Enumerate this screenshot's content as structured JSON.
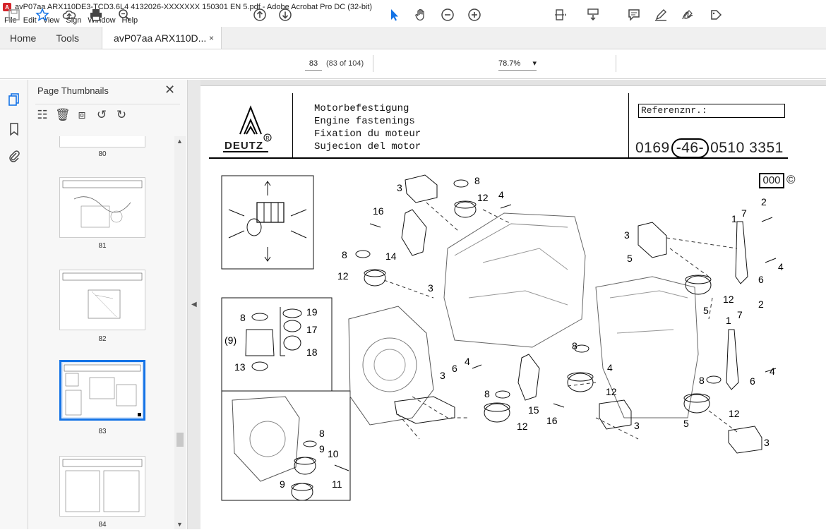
{
  "window": {
    "title": "avP07aa ARX110DE3-TCD3.6L4 4132026-XXXXXXX 150301 EN 5.pdf - Adobe Acrobat Pro DC (32-bit)",
    "app_icon": "acrobat-icon"
  },
  "menu": [
    "File",
    "Edit",
    "View",
    "Sign",
    "Window",
    "Help"
  ],
  "tabs": {
    "home": "Home",
    "tools": "Tools",
    "document": "avP07aa ARX110D...",
    "close": "×"
  },
  "toolbar": {
    "page_current": "83",
    "page_count": "(83 of 104)",
    "zoom": "78.7%",
    "zoom_caret": "▾"
  },
  "panel": {
    "title": "Page Thumbnails",
    "close": "✕",
    "thumbnails": [
      {
        "label": "80",
        "selected": false
      },
      {
        "label": "81",
        "selected": false
      },
      {
        "label": "82",
        "selected": false
      },
      {
        "label": "83",
        "selected": true
      },
      {
        "label": "84",
        "selected": false
      }
    ]
  },
  "document": {
    "titles": [
      "Motorbefestigung",
      "Engine fastenings",
      "Fixation du moteur",
      "Sujecion del motor"
    ],
    "logo_text": "DEUTZ",
    "ref_label": "Referenznr.:",
    "ref_prefix": "0169",
    "ref_oval": "-46-",
    "ref_rest": "0510  3351",
    "code_box": "000",
    "code_symbol": "©",
    "callouts": [
      "3",
      "8",
      "12",
      "4",
      "16",
      "14",
      "8",
      "12",
      "3",
      "3",
      "5",
      "1",
      "7",
      "2",
      "5",
      "12",
      "4",
      "6",
      "8",
      "19",
      "(9)",
      "17",
      "18",
      "13",
      "8",
      "4",
      "1",
      "7",
      "2",
      "4",
      "3",
      "6",
      "4",
      "8",
      "12",
      "6",
      "15",
      "16",
      "3",
      "8",
      "12",
      "8",
      "9",
      "10",
      "9",
      "11",
      "3",
      "5",
      "12",
      "3",
      "12"
    ]
  }
}
